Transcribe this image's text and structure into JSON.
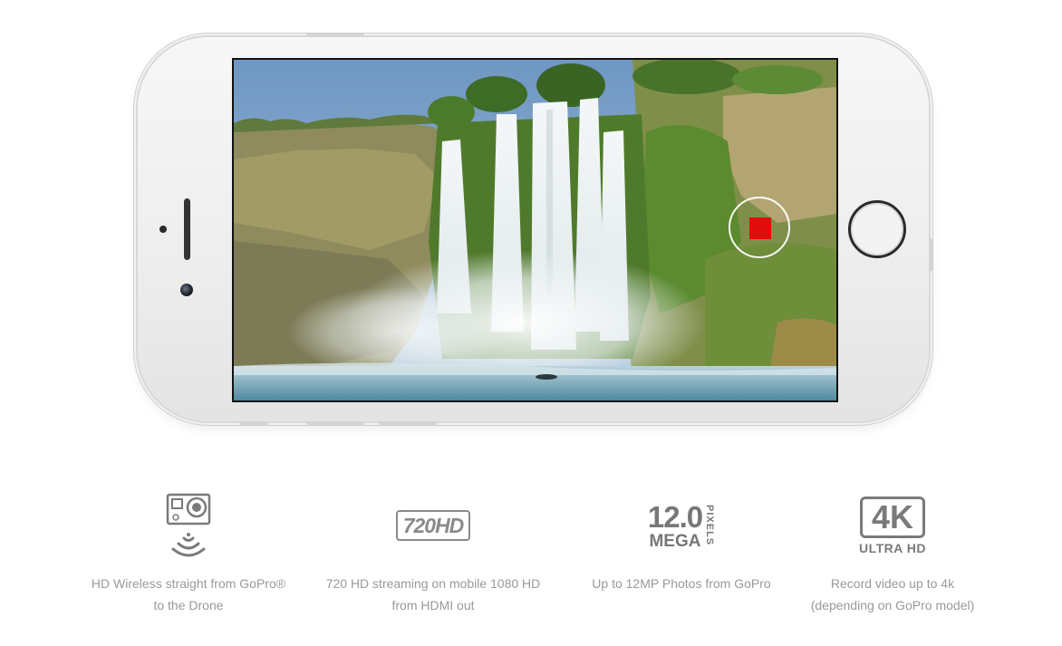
{
  "phone": {
    "record_button_state": "recording"
  },
  "colors": {
    "record": "#e10d0d",
    "caption_text": "#999999",
    "icon_gray": "#7a7a7a"
  },
  "features": [
    {
      "icon": "gopro-wireless-icon",
      "line1": "HD Wireless straight from GoPro®",
      "line2": "to the Drone"
    },
    {
      "icon": "720hd-icon",
      "icon_text": "720",
      "icon_text2": "HD",
      "line1": "720 HD streaming on mobile 1080 HD",
      "line2": "from HDMI out"
    },
    {
      "icon": "megapixels-icon",
      "icon_num": "12.0",
      "icon_mega": "MEGA",
      "icon_pixels": "PIXELS",
      "line1": "Up to 12MP Photos from GoPro",
      "line2": ""
    },
    {
      "icon": "4k-ultra-hd-icon",
      "icon_main": "4K",
      "icon_sub": "ULTRA HD",
      "line1": "Record video up to 4k",
      "line2": "(depending on GoPro model)"
    }
  ]
}
